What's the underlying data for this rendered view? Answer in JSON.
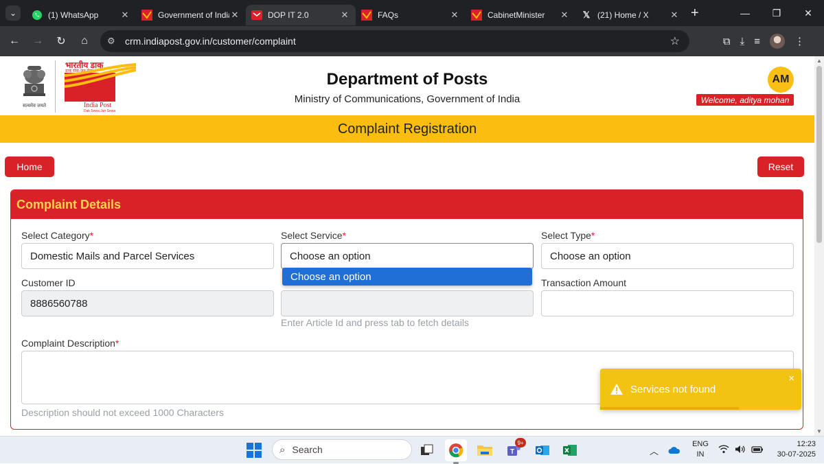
{
  "browser": {
    "tabs": [
      {
        "title": "(1) WhatsApp",
        "icon": "whatsapp-icon",
        "active": false
      },
      {
        "title": "Government of India",
        "icon": "indiapost-icon",
        "active": false
      },
      {
        "title": "DOP IT 2.0",
        "icon": "dop-icon",
        "active": true
      },
      {
        "title": "FAQs",
        "icon": "indiapost-icon",
        "active": false
      },
      {
        "title": "CabinetMinister",
        "icon": "indiapost-icon",
        "active": false
      },
      {
        "title": "(21) Home / X",
        "icon": "x-icon",
        "active": false
      }
    ],
    "url": "crm.indiapost.gov.in/customer/complaint"
  },
  "header": {
    "logo_hindi": "भारतीय डाक",
    "logo_hindi_tag": "डाक सेवा-जन सेवा",
    "logo_english": "India Post",
    "logo_tagline": "Dak Sewa Jan Sewa",
    "emblem_motto": "सत्यमेव जयते",
    "title": "Department of Posts",
    "subtitle": "Ministry of Communications, Government of India",
    "avatar_initials": "AM",
    "welcome": "Welcome, aditya mohan"
  },
  "page": {
    "banner": "Complaint Registration",
    "home_label": "Home",
    "reset_label": "Reset"
  },
  "form": {
    "section_title": "Complaint Details",
    "required_mark": "*",
    "category_label": "Select Category",
    "category_value": "Domestic Mails and Parcel Services",
    "service_label": "Select Service",
    "service_value": "Choose an option",
    "type_label": "Select Type",
    "type_value": "Choose an option",
    "customer_id_label": "Customer ID",
    "customer_id_value": "8886560788",
    "article_value": "",
    "article_hint": "Enter Article Id and press tab to fetch details",
    "amount_label": "Transaction Amount",
    "amount_value": "",
    "description_label": "Complaint Description",
    "description_hint": "Description should not exceed 1000 Characters",
    "dropdown_option": "Choose an option"
  },
  "toast": {
    "message": "Services not found",
    "close": "×",
    "progress": 0.69
  },
  "taskbar": {
    "search_placeholder": "Search",
    "teams_badge": "9+",
    "lang_line1": "ENG",
    "lang_line2": "IN",
    "time": "12:23",
    "date": "30-07-2025"
  },
  "colors": {
    "brand_red": "#d92128",
    "brand_yellow": "#fcbd11",
    "dropdown_blue": "#1f6fd6",
    "toast_yellow": "#f2c313"
  }
}
